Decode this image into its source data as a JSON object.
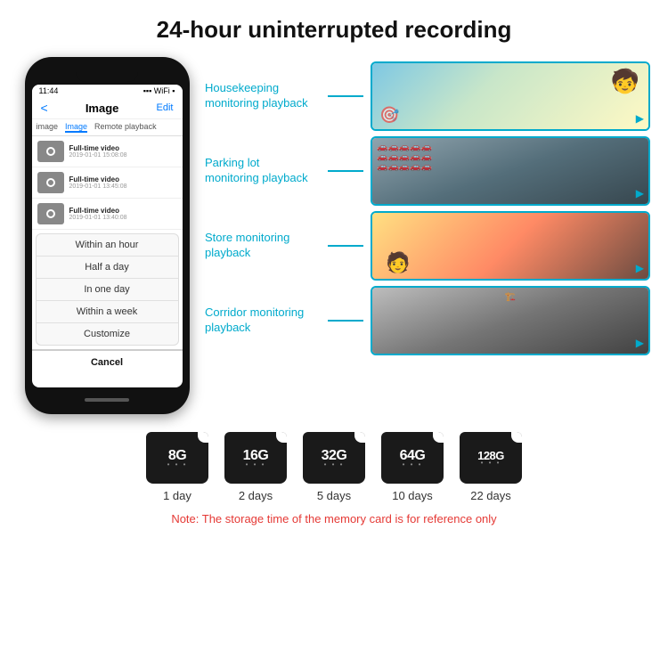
{
  "header": {
    "title": "24-hour uninterrupted recording"
  },
  "phone": {
    "status_time": "11:44",
    "nav_back": "<",
    "nav_title": "Image",
    "nav_edit": "Edit",
    "tabs": [
      "image",
      "Image",
      "Remote playback"
    ],
    "list_items": [
      {
        "title": "Full-time video",
        "date": "2019-01-01 15:08:08"
      },
      {
        "title": "Full-time video",
        "date": "2019-01-01 13:45:08"
      },
      {
        "title": "Full-time video",
        "date": "2019-01-01 13:40:08"
      }
    ],
    "dropdown_items": [
      "Within an hour",
      "Half a day",
      "In one day",
      "Within a week",
      "Customize"
    ],
    "cancel_label": "Cancel"
  },
  "panels": [
    {
      "label": "Housekeeping\nmonitoring playback",
      "img_type": "housekeeping"
    },
    {
      "label": "Parking lot\nmonitoring playback",
      "img_type": "parking"
    },
    {
      "label": "Store monitoring\nplayback",
      "img_type": "store"
    },
    {
      "label": "Corridor monitoring\nplayback",
      "img_type": "corridor"
    }
  ],
  "storage_cards": [
    {
      "size": "8G",
      "days": "1 day"
    },
    {
      "size": "16G",
      "days": "2 days"
    },
    {
      "size": "32G",
      "days": "5 days"
    },
    {
      "size": "64G",
      "days": "10 days"
    },
    {
      "size": "128G",
      "days": "22 days"
    }
  ],
  "note": "Note: The storage time of the memory card is for reference only",
  "colors": {
    "accent": "#00aacc",
    "note_red": "#e53935",
    "phone_bg": "#111111"
  }
}
